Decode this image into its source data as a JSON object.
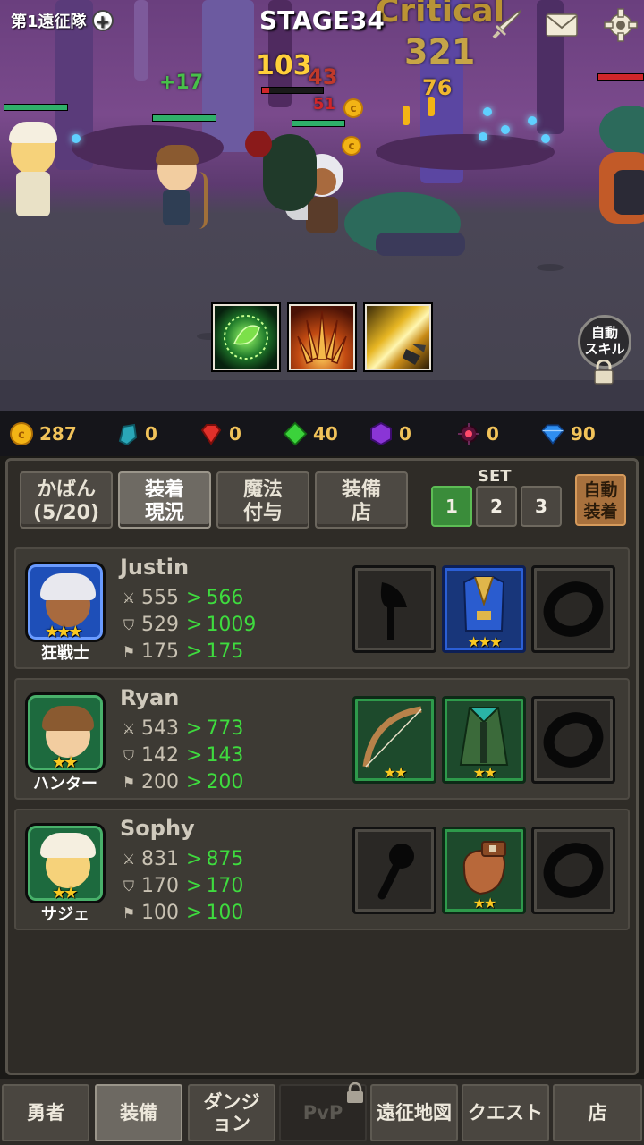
{
  "header": {
    "team_label": "第1遠征隊",
    "stage": "STAGE34",
    "add_icon": "plus-circle-icon",
    "icons": [
      "sword-icon",
      "mail-icon",
      "gear-icon"
    ]
  },
  "battle": {
    "damage_texts": [
      "Critical",
      "321",
      "103",
      "43",
      "51",
      "76",
      "+17"
    ],
    "auto_skill_label_1": "自動",
    "auto_skill_label_2": "スキル",
    "skills": [
      "leaf-skill-icon",
      "spikes-skill-icon",
      "slash-skill-icon"
    ]
  },
  "currency": [
    {
      "icon": "gold-coin-icon",
      "value": "287",
      "color": "#f3b415"
    },
    {
      "icon": "blue-stone-icon",
      "value": "0",
      "color": "#2aa7b8"
    },
    {
      "icon": "red-gem-icon",
      "value": "0",
      "color": "#e0302a"
    },
    {
      "icon": "green-gem-icon",
      "value": "40",
      "color": "#3bd23b"
    },
    {
      "icon": "purple-gem-icon",
      "value": "0",
      "color": "#8a35d6"
    },
    {
      "icon": "dark-orb-icon",
      "value": "0",
      "color": "#a02060"
    },
    {
      "icon": "diamond-icon",
      "value": "90",
      "color": "#2f8ef0"
    }
  ],
  "tabs": {
    "bag_1": "かばん",
    "bag_2": "(5/20)",
    "equip_1": "装着",
    "equip_2": "現況",
    "magic_1": "魔法",
    "magic_2": "付与",
    "shop_1": "装備",
    "shop_2": "店"
  },
  "set": {
    "label": "SET",
    "options": [
      "1",
      "2",
      "3"
    ],
    "selected": "1",
    "auto_equip_1": "自動",
    "auto_equip_2": "装着"
  },
  "heroes": [
    {
      "name": "Justin",
      "class": "狂戦士",
      "stars": "★★★",
      "attack_old": "555",
      "attack_new": "566",
      "defense_old": "529",
      "defense_new": "1009",
      "speed_old": "175",
      "speed_new": "175",
      "slots": [
        {
          "item": "axe-silhouette-icon",
          "stars": ""
        },
        {
          "item": "blue-armor-icon",
          "stars": "★★★"
        },
        {
          "item": "ring-silhouette-icon",
          "stars": ""
        }
      ]
    },
    {
      "name": "Ryan",
      "class": "ハンター",
      "stars": "★★",
      "attack_old": "543",
      "attack_new": "773",
      "defense_old": "142",
      "defense_new": "143",
      "speed_old": "200",
      "speed_new": "200",
      "slots": [
        {
          "item": "bow-icon",
          "stars": "★★"
        },
        {
          "item": "green-cloak-icon",
          "stars": "★★"
        },
        {
          "item": "ring-silhouette-icon",
          "stars": ""
        }
      ]
    },
    {
      "name": "Sophy",
      "class": "サジェ",
      "stars": "★★",
      "attack_old": "831",
      "attack_new": "875",
      "defense_old": "170",
      "defense_new": "170",
      "speed_old": "100",
      "speed_new": "100",
      "slots": [
        {
          "item": "staff-silhouette-icon",
          "stars": ""
        },
        {
          "item": "gauntlet-icon",
          "stars": "★★"
        },
        {
          "item": "ring-silhouette-icon",
          "stars": ""
        }
      ]
    }
  ],
  "stat_separator": ">",
  "nav": {
    "hero": "勇者",
    "equip": "装備",
    "dungeon_1": "ダンジ",
    "dungeon_2": "ョン",
    "pvp": "PvP",
    "map": "遠征地図",
    "quest": "クエスト",
    "shop": "店"
  }
}
